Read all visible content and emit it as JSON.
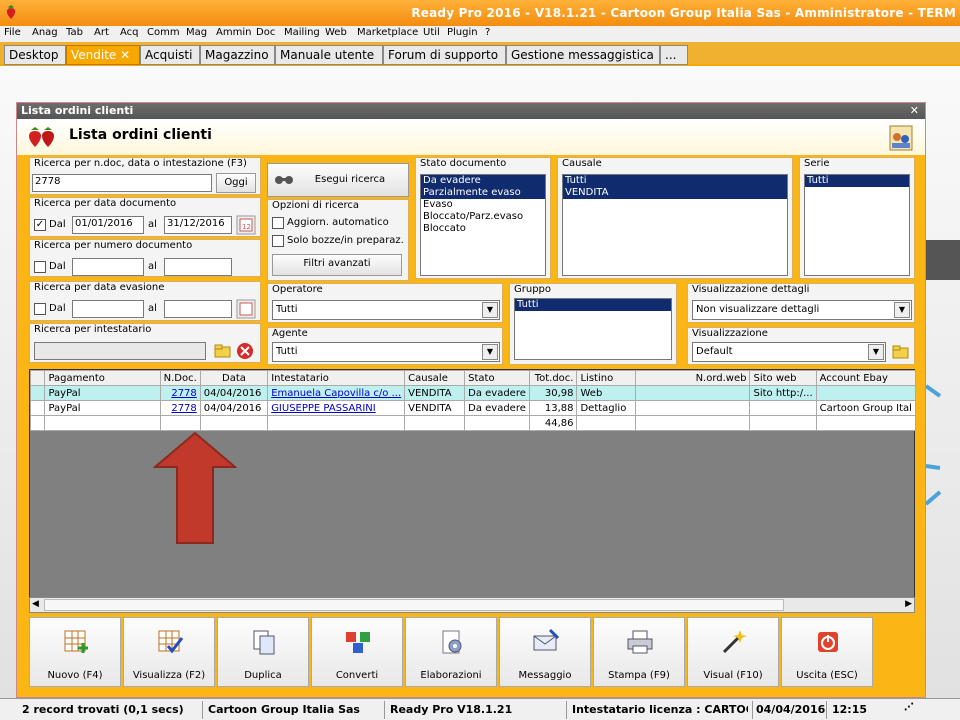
{
  "app": {
    "title": "Ready Pro 2016 - V18.1.21 - Cartoon Group Italia Sas - Amministratore - TERM"
  },
  "menu": [
    "File",
    "Anag",
    "Tab",
    "Art",
    "Acq",
    "Comm",
    "Mag",
    "Ammin",
    "Doc",
    "Mailing",
    "Web",
    "Marketplace",
    "Util",
    "Plugin",
    "?"
  ],
  "tabs": [
    {
      "label": "Desktop"
    },
    {
      "label": "Vendite",
      "close": "✕"
    },
    {
      "label": "Acquisti"
    },
    {
      "label": "Magazzino"
    },
    {
      "label": "Manuale utente"
    },
    {
      "label": "Forum di supporto"
    },
    {
      "label": "Gestione messaggistica"
    },
    {
      "label": "..."
    }
  ],
  "window": {
    "title": "Lista ordini clienti",
    "close": "✕",
    "header": "Lista ordini clienti"
  },
  "search": {
    "doc_label": "Ricerca per n.doc, data o intestazione (F3)",
    "doc_value": "2778",
    "oggi_label": "Oggi",
    "date_label": "Ricerca per data documento",
    "date_dal_label": "Dal",
    "date_from": "01/01/2016",
    "date_al_label": "al",
    "date_to": "31/12/2016",
    "num_label": "Ricerca per numero documento",
    "num_dal_label": "Dal",
    "num_al_label": "al",
    "evas_label": "Ricerca per data evasione",
    "evas_dal_label": "Dal",
    "evas_al_label": "al",
    "intest_label": "Ricerca per intestatario",
    "esegui_label": "Esegui ricerca",
    "options_label": "Opzioni di ricerca",
    "opt_auto": "Aggiorn. automatico",
    "opt_bozze": "Solo bozze/in preparaz.",
    "filtri_label": "Filtri avanzati",
    "operatore_label": "Operatore",
    "operatore_value": "Tutti",
    "agente_label": "Agente",
    "agente_value": "Tutti",
    "stato_label": "Stato documento",
    "stato_items": [
      "Da evadere",
      "Parzialmente evaso",
      "Evaso",
      "Bloccato/Parz.evaso",
      "Bloccato"
    ],
    "causale_label": "Causale",
    "causale_items": [
      "Tutti",
      "VENDITA"
    ],
    "serie_label": "Serie",
    "serie_items": [
      "Tutti"
    ],
    "gruppo_label": "Gruppo",
    "gruppo_items": [
      "Tutti"
    ],
    "visdett_label": "Visualizzazione dettagli",
    "visdett_value": "Non visualizzare dettagli",
    "vis_label": "Visualizzazione",
    "vis_value": "Default"
  },
  "grid": {
    "headers": [
      "Pagamento",
      "N.Doc.",
      "Data",
      "Intestatario",
      "Causale",
      "Stato",
      "Tot.doc.",
      "Listino",
      "N.ord.web",
      "Sito web",
      "Account Ebay"
    ],
    "rows": [
      [
        "PayPal",
        "2778",
        "04/04/2016",
        "Emanuela Capovilla c/o ...",
        "VENDITA",
        "Da evadere",
        "30,98",
        "Web",
        "",
        "Sito http:/...",
        ""
      ],
      [
        "PayPal",
        "2778",
        "04/04/2016",
        "GIUSEPPE PASSARINI",
        "VENDITA",
        "Da evadere",
        "13,88",
        "Dettaglio",
        "",
        "",
        "Cartoon Group Ital"
      ]
    ],
    "total": "44,86"
  },
  "toolbar": [
    "Nuovo (F4)",
    "Visualizza (F2)",
    "Duplica",
    "Converti",
    "Elaborazioni",
    "Messaggio",
    "Stampa (F9)",
    "Visual (F10)",
    "Uscita (ESC)"
  ],
  "status": {
    "records": "2 record trovati (0,1 secs)",
    "company": "Cartoon Group Italia Sas",
    "version": "Ready Pro V18.1.21",
    "license": "Intestatario licenza : CARTOON GF",
    "date": "04/04/2016",
    "time": "12:15"
  },
  "colors": {
    "accent": "#f6a800",
    "selection": "#102c6e",
    "arrow": "#c0392b"
  }
}
